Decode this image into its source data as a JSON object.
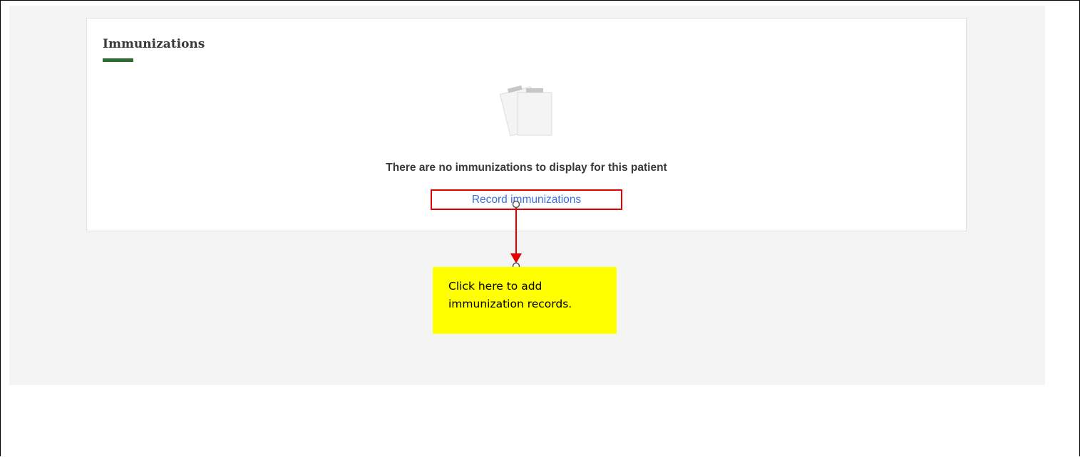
{
  "card": {
    "title": "Immunizations",
    "empty_message": "There are no immunizations to display for this patient",
    "record_link_label": "Record immunizations",
    "illustration_icon": "clipboard-icon"
  },
  "callout": {
    "text": "Click here to add immunization records."
  },
  "colors": {
    "accent_green": "#2e6b30",
    "link_blue": "#3b6fe0",
    "highlight_red": "#e30000",
    "callout_yellow": "#ffff00",
    "panel_gray": "#f4f4f4"
  }
}
